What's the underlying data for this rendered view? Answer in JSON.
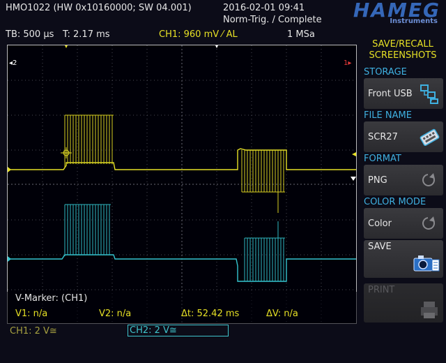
{
  "header": {
    "device": "HMO1022 (HW 0x10160000; SW 04.001)",
    "datetime": "2016-02-01 09:41",
    "trigger_status": "Norm-Trig. / Complete",
    "logo": "HAMEG",
    "logo_sub": "Instruments"
  },
  "status_bar": {
    "timebase": "TB: 500 µs",
    "trigger_time": "T: 2.17 ms",
    "ch1_trigger": "CH1: 960 mV ⁄ AL",
    "sample_rate": "1 MSa"
  },
  "display": {
    "ch1_marker": "1",
    "ch2_marker": "2",
    "left_marker": "◂2",
    "right_marker": "1▸"
  },
  "markers": {
    "title": "V-Marker: (CH1)",
    "v1": "V1: n/a",
    "v2": "V2: n/a",
    "dt": "Δt: 52.42 ms",
    "dv": "ΔV: n/a"
  },
  "channels": {
    "ch1_label": "CH1: 2 V≅",
    "ch2_label": "CH2: 2 V≅"
  },
  "side_menu": {
    "title_line1": "SAVE/RECALL",
    "title_line2": "SCREENSHOTS",
    "storage_label": "STORAGE",
    "storage_value": "Front USB",
    "filename_label": "FILE NAME",
    "filename_value": "SCR27",
    "format_label": "FORMAT",
    "format_value": "PNG",
    "colormode_label": "COLOR MODE",
    "colormode_value": "Color",
    "save_label": "SAVE",
    "print_label": "PRINT"
  },
  "colors": {
    "ch1": "#e6e025",
    "ch2": "#35c6cf",
    "accent": "#3fb0e0",
    "menu_title": "#e6e025"
  },
  "icons": [
    "usb-storage-icon",
    "keyboard-edit-icon",
    "cycle-icon",
    "camera-icon",
    "printer-icon"
  ]
}
